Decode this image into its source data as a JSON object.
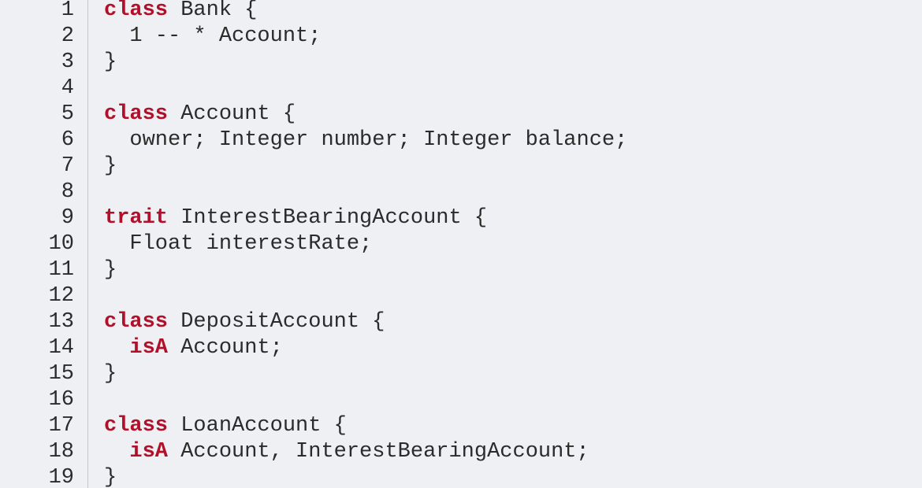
{
  "editor": {
    "colors": {
      "background": "#eff0f3",
      "keyword": "#b0102a",
      "text": "#2b2b2b",
      "gutter_divider": "#c8c8cc"
    },
    "lines": [
      {
        "number": "1",
        "tokens": [
          {
            "text": "class",
            "kw": true
          },
          {
            "text": " Bank {"
          }
        ]
      },
      {
        "number": "2",
        "tokens": [
          {
            "text": "  1 -- * Account;"
          }
        ]
      },
      {
        "number": "3",
        "tokens": [
          {
            "text": "}"
          }
        ]
      },
      {
        "number": "4",
        "tokens": []
      },
      {
        "number": "5",
        "tokens": [
          {
            "text": "class",
            "kw": true
          },
          {
            "text": " Account {"
          }
        ]
      },
      {
        "number": "6",
        "tokens": [
          {
            "text": "  owner; Integer number; Integer balance;"
          }
        ]
      },
      {
        "number": "7",
        "tokens": [
          {
            "text": "}"
          }
        ]
      },
      {
        "number": "8",
        "tokens": []
      },
      {
        "number": "9",
        "tokens": [
          {
            "text": "trait",
            "kw": true
          },
          {
            "text": " InterestBearingAccount {"
          }
        ]
      },
      {
        "number": "10",
        "tokens": [
          {
            "text": "  Float interestRate;"
          }
        ]
      },
      {
        "number": "11",
        "tokens": [
          {
            "text": "}"
          }
        ]
      },
      {
        "number": "12",
        "tokens": []
      },
      {
        "number": "13",
        "tokens": [
          {
            "text": "class",
            "kw": true
          },
          {
            "text": " DepositAccount {"
          }
        ]
      },
      {
        "number": "14",
        "tokens": [
          {
            "text": "  "
          },
          {
            "text": "isA",
            "kw": true
          },
          {
            "text": " Account;"
          }
        ]
      },
      {
        "number": "15",
        "tokens": [
          {
            "text": "}"
          }
        ]
      },
      {
        "number": "16",
        "tokens": []
      },
      {
        "number": "17",
        "tokens": [
          {
            "text": "class",
            "kw": true
          },
          {
            "text": " LoanAccount {"
          }
        ]
      },
      {
        "number": "18",
        "tokens": [
          {
            "text": "  "
          },
          {
            "text": "isA",
            "kw": true
          },
          {
            "text": " Account, InterestBearingAccount;"
          }
        ]
      },
      {
        "number": "19",
        "tokens": [
          {
            "text": "}"
          }
        ]
      }
    ]
  }
}
